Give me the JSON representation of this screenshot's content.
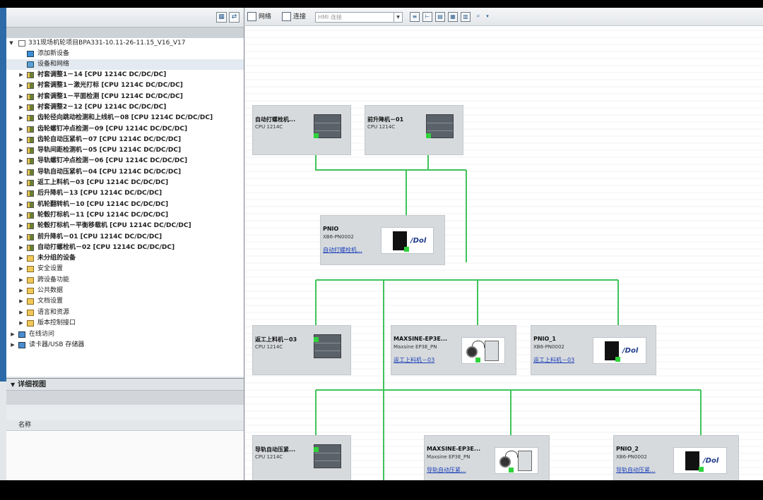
{
  "project": {
    "root_label": "331现场机轮项目BPA331-10.11-26-11.15_V16_V17",
    "add_device": "添加新设备",
    "devices_networks": "设备和网络"
  },
  "tree_items": [
    {
      "label": "衬套调整1－14 [CPU 1214C DC/DC/DC]"
    },
    {
      "label": "衬套调整1－激光打标 [CPU 1214C DC/DC/DC]"
    },
    {
      "label": "衬套调整1－平面检测 [CPU 1214C DC/DC/DC]"
    },
    {
      "label": "衬套调整2－12 [CPU 1214C DC/DC/DC]"
    },
    {
      "label": "齿轮径向跳动检测和上线机－08 [CPU 1214C DC/DC/DC]"
    },
    {
      "label": "齿轮螺钉冲点检测－09 [CPU 1214C DC/DC/DC]"
    },
    {
      "label": "齿轮自动压紧机－07 [CPU 1214C DC/DC/DC]"
    },
    {
      "label": "导轨间距检测机－05 [CPU 1214C DC/DC/DC]"
    },
    {
      "label": "导轨螺钉冲点检测－06 [CPU 1214C DC/DC/DC]"
    },
    {
      "label": "导轨自动压紧机－04 [CPU 1214C DC/DC/DC]"
    },
    {
      "label": "返工上料机－03 [CPU 1214C DC/DC/DC]"
    },
    {
      "label": "后升降机－13 [CPU 1214C DC/DC/DC]"
    },
    {
      "label": "机轮翻转机－10 [CPU 1214C DC/DC/DC]"
    },
    {
      "label": "轮毂打标机－11 [CPU 1214C DC/DC/DC]"
    },
    {
      "label": "轮毂打标机－平衡移载机 [CPU 1214C DC/DC/DC]"
    },
    {
      "label": "前升降机－01 [CPU 1214C DC/DC/DC]"
    },
    {
      "label": "自动打螺栓机－02 [CPU 1214C DC/DC/DC]"
    }
  ],
  "tree_folders": [
    {
      "label": "未分组的设备",
      "bold": true
    },
    {
      "label": "安全设置"
    },
    {
      "label": "跨设备功能"
    },
    {
      "label": "公共数据"
    },
    {
      "label": "文档设置"
    },
    {
      "label": "语言和资源"
    },
    {
      "label": "版本控制接口"
    }
  ],
  "tree_bottom": [
    {
      "label": "在线访问"
    },
    {
      "label": "读卡器/USB 存储器"
    }
  ],
  "detail": {
    "title": "详细视图",
    "column_name": "名称"
  },
  "canvas_toolbar": {
    "network": "网络",
    "connections": "连接",
    "hmi_placeholder": "HMI 连接"
  },
  "devices": [
    {
      "id": "d1",
      "name": "自动打螺栓机...",
      "type": "CPU 1214C",
      "link": "",
      "kind": "plc"
    },
    {
      "id": "d2",
      "name": "前升降机－01",
      "type": "CPU 1214C",
      "link": "",
      "kind": "plc"
    },
    {
      "id": "d3",
      "name": "PNIO",
      "type": "XB6-PN0002",
      "link": "自动打螺栓机...",
      "kind": "io"
    },
    {
      "id": "d4",
      "name": "返工上料机－03",
      "type": "CPU 1214C",
      "link": "",
      "kind": "plc"
    },
    {
      "id": "d5",
      "name": "MAXSINE-EP3E...",
      "type": "Maxsine EP3E_PN",
      "link": "返工上料机－03",
      "kind": "drive"
    },
    {
      "id": "d6",
      "name": "PNIO_1",
      "type": "XB6-PN0002",
      "link": "返工上料机－03",
      "kind": "io"
    },
    {
      "id": "d7",
      "name": "导轨自动压紧...",
      "type": "CPU 1214C",
      "link": "",
      "kind": "plc"
    },
    {
      "id": "d8",
      "name": "MAXSINE-EP3E...",
      "type": "Maxsine EP3E_PN",
      "link": "导轨自动压紧...",
      "kind": "drive"
    },
    {
      "id": "d9",
      "name": "PNIO_2",
      "type": "XB6-PN0002",
      "link": "导轨自动压紧...",
      "kind": "io"
    }
  ],
  "logo_text": "/Dol",
  "colors": {
    "profinet": "#3ec45a",
    "port": "#2fd23b",
    "link": "#1a3fb8"
  }
}
